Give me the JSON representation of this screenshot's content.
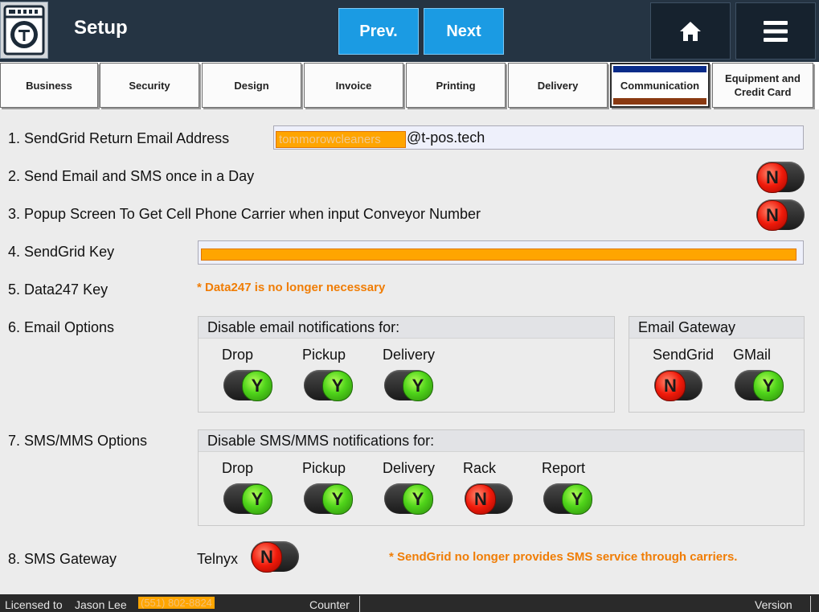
{
  "header": {
    "title": "Setup",
    "prev_label": "Prev.",
    "next_label": "Next"
  },
  "tabs": [
    {
      "label": "Business"
    },
    {
      "label": "Security"
    },
    {
      "label": "Design"
    },
    {
      "label": "Invoice"
    },
    {
      "label": "Printing"
    },
    {
      "label": "Delivery"
    },
    {
      "label": "Communication",
      "active": true
    },
    {
      "label": "Equipment and Credit Card"
    }
  ],
  "settings": {
    "return_email": {
      "label": "1. SendGrid Return Email Address",
      "user_part": "tommorowcleaners",
      "domain": "@t-pos.tech"
    },
    "once_a_day": {
      "label": "2. Send Email and SMS once in a Day",
      "value": "N"
    },
    "popup_carrier": {
      "label": "3. Popup Screen To Get Cell Phone Carrier when input Conveyor Number",
      "value": "N"
    },
    "sendgrid_key": {
      "label": "4. SendGrid Key"
    },
    "data247": {
      "label": "5. Data247 Key",
      "note": "* Data247 is no longer necessary"
    },
    "email_options": {
      "label": "6. Email Options",
      "disable_header": "Disable email notifications for:",
      "items": [
        {
          "label": "Drop",
          "value": "Y"
        },
        {
          "label": "Pickup",
          "value": "Y"
        },
        {
          "label": "Delivery",
          "value": "Y"
        }
      ],
      "gateway_header": "Email Gateway",
      "gateways": [
        {
          "label": "SendGrid",
          "value": "N"
        },
        {
          "label": "GMail",
          "value": "Y"
        }
      ]
    },
    "sms_options": {
      "label": "7. SMS/MMS Options",
      "disable_header": "Disable SMS/MMS notifications for:",
      "items": [
        {
          "label": "Drop",
          "value": "Y"
        },
        {
          "label": "Pickup",
          "value": "Y"
        },
        {
          "label": "Delivery",
          "value": "Y"
        },
        {
          "label": "Rack",
          "value": "N"
        },
        {
          "label": "Report",
          "value": "Y"
        }
      ]
    },
    "sms_gateway": {
      "label": "8. SMS Gateway",
      "provider": "Telnyx",
      "value": "N",
      "note": "* SendGrid no longer provides SMS service through carriers."
    }
  },
  "statusbar": {
    "licensed_label": "Licensed to",
    "licensee": "Jason Lee",
    "phone": "(551) 802-8824",
    "counter": "Counter",
    "version": "Version"
  },
  "colors": {
    "header_bg": "#253443",
    "nav_blue": "#1b9be3",
    "note_orange": "#f07d05",
    "toggle_yes": "#4fd41a",
    "toggle_no": "#f01a0a"
  }
}
